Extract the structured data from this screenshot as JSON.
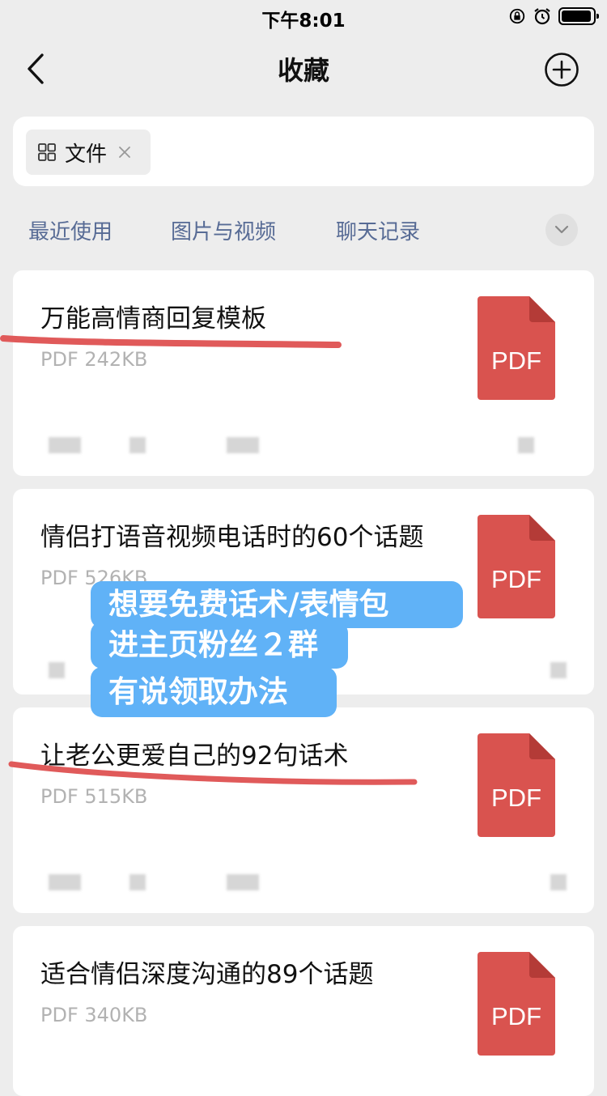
{
  "status_bar": {
    "time": "下午8:01"
  },
  "nav": {
    "title": "收藏"
  },
  "search": {
    "chip_label": "文件"
  },
  "category_tabs": [
    {
      "label": "最近使用"
    },
    {
      "label": "图片与视频"
    },
    {
      "label": "聊天记录"
    }
  ],
  "files": [
    {
      "title": "万能高情商回复模板",
      "meta": "PDF 242KB",
      "type_label": "PDF"
    },
    {
      "title": "情侣打语音视频电话时的60个话题",
      "meta": "PDF 526KB",
      "type_label": "PDF"
    },
    {
      "title": "让老公更爱自己的92句话术",
      "meta": "PDF 515KB",
      "type_label": "PDF"
    },
    {
      "title": "适合情侣深度沟通的89个话题",
      "meta": "PDF 340KB",
      "type_label": "PDF"
    }
  ],
  "promo_overlay": {
    "lines": [
      "想要免费话术/表情包",
      "进主页粉丝２群",
      "有说领取办法"
    ]
  },
  "colors": {
    "background": "#ededed",
    "link_blue": "#576b95",
    "pdf_red": "#d9534f",
    "annotation_red": "#e05a5a",
    "promo_blue": "#60b2f7"
  }
}
